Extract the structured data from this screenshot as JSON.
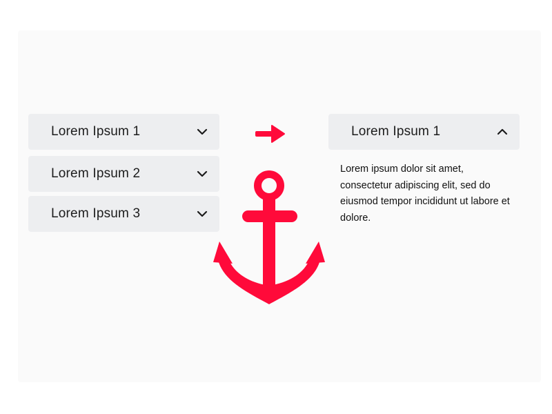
{
  "accent_color": "#ff0a3a",
  "left_accordion": {
    "items": [
      {
        "label": "Lorem Ipsum 1",
        "icon": "chevron-down-icon"
      },
      {
        "label": "Lorem Ipsum 2",
        "icon": "chevron-down-icon"
      },
      {
        "label": "Lorem Ipsum 3",
        "icon": "chevron-down-icon"
      }
    ]
  },
  "transition_icon": "arrow-right-icon",
  "decoration_icon": "anchor-icon",
  "right_accordion": {
    "label": "Lorem Ipsum 1",
    "icon": "chevron-up-icon",
    "content": "Lorem ipsum dolor sit amet, consectetur adipiscing elit, sed do eiusmod tempor incididunt ut labore et dolore."
  }
}
